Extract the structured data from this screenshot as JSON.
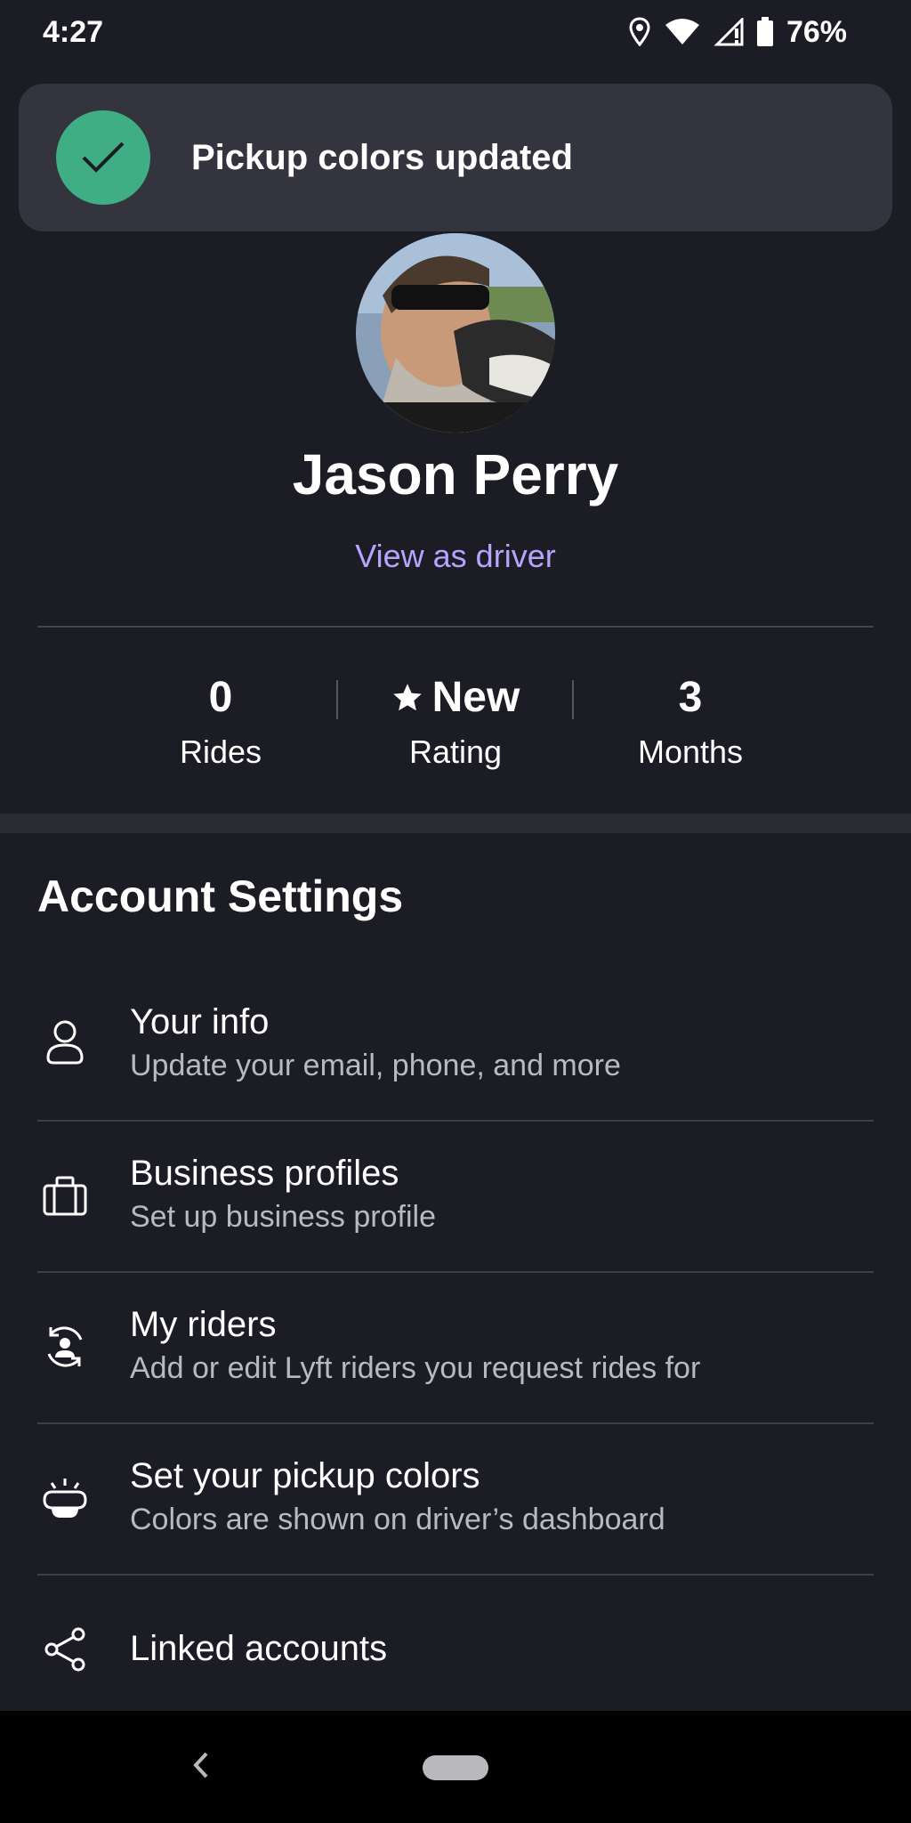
{
  "status_bar": {
    "time": "4:27",
    "battery": "76%",
    "icons": [
      "location-icon",
      "wifi-icon",
      "signal-icon",
      "battery-icon"
    ]
  },
  "toast": {
    "message": "Pickup colors updated",
    "icon": "check-icon",
    "accent": "#3fae84"
  },
  "profile": {
    "name": "Jason Perry",
    "view_as_driver": "View as driver"
  },
  "stats": [
    {
      "value": "0",
      "label": "Rides"
    },
    {
      "value": "New",
      "label": "Rating",
      "icon": "star-icon"
    },
    {
      "value": "3",
      "label": "Months"
    }
  ],
  "account_settings": {
    "title": "Account Settings",
    "items": [
      {
        "title": "Your info",
        "subtitle": "Update your email, phone, and more",
        "icon": "person-icon"
      },
      {
        "title": "Business profiles",
        "subtitle": "Set up business profile",
        "icon": "briefcase-icon"
      },
      {
        "title": "My riders",
        "subtitle": "Add or edit Lyft riders you request rides for",
        "icon": "riders-icon"
      },
      {
        "title": "Set your pickup colors",
        "subtitle": "Colors are shown on driver’s dashboard",
        "icon": "amp-light-icon"
      },
      {
        "title": "Linked accounts",
        "subtitle": "",
        "icon": "share-icon"
      }
    ]
  },
  "colors": {
    "background": "#1c1c24",
    "link": "#b6a4ff",
    "toast_bg": "#34343f"
  }
}
